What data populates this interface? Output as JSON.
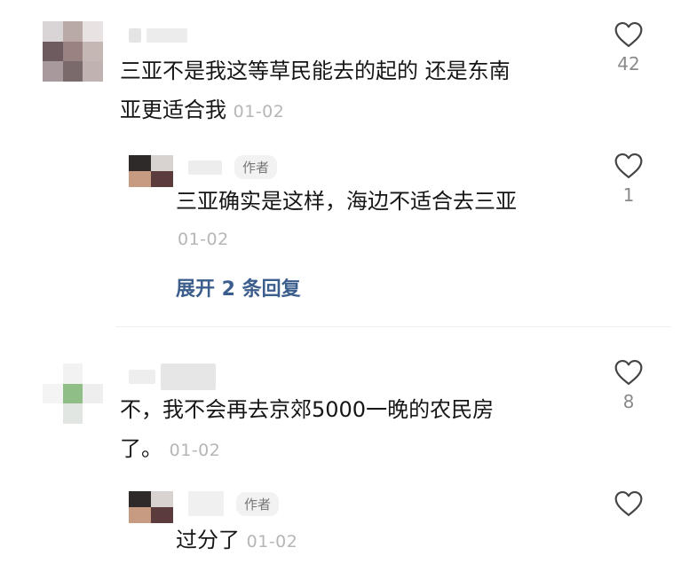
{
  "comments": [
    {
      "text_line1": "三亚不是我这等草民能去的起的  还是东南",
      "text_line2": "亚更适合我",
      "time": "01-02",
      "likes": "42",
      "reply": {
        "badge": "作者",
        "text": "三亚确实是这样，海边不适合去三亚",
        "time": "01-02",
        "likes": "1",
        "expand_label": "展开 2 条回复"
      }
    },
    {
      "text_line1": "不，我不会再去京郊5000一晚的农民房",
      "text_line2": "了。",
      "time": "01-02",
      "likes": "8",
      "reply": {
        "badge": "作者",
        "text": "过分了",
        "time": "01-02"
      }
    }
  ]
}
